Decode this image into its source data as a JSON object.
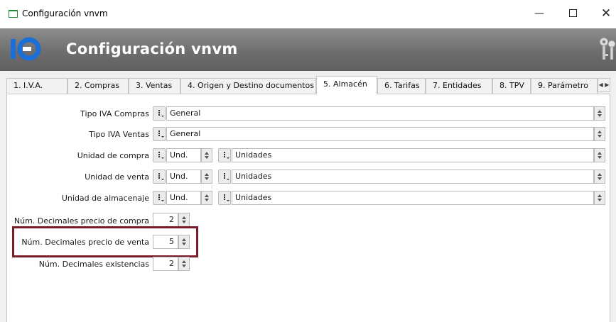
{
  "window": {
    "title": "Configuración vnvm",
    "minimize_icon": "minimize-icon",
    "maximize_icon": "maximize-icon",
    "close_icon": "close-icon",
    "minimize_glyph": "—",
    "close_glyph": "✕"
  },
  "header": {
    "title": "Configuración vnvm",
    "logo_icon": "app-logo",
    "keys_icon": "keys-icon",
    "brand_color": "#1c6fd6"
  },
  "tabs": [
    {
      "label": "1. I.V.A.",
      "active": false
    },
    {
      "label": "2. Compras",
      "active": false
    },
    {
      "label": "3. Ventas",
      "active": false
    },
    {
      "label": "4. Origen y Destino documentos",
      "active": false
    },
    {
      "label": "5. Almacén",
      "active": true
    },
    {
      "label": "6. Tarifas",
      "active": false
    },
    {
      "label": "7. Entidades",
      "active": false
    },
    {
      "label": "8. TPV",
      "active": false
    },
    {
      "label": "9. Parámetro",
      "active": false
    }
  ],
  "tab_scroll": {
    "left": "◀",
    "right": "▶"
  },
  "form": {
    "tipo_iva_compras": {
      "label": "Tipo IVA Compras",
      "value": "General"
    },
    "tipo_iva_ventas": {
      "label": "Tipo IVA Ventas",
      "value": "General"
    },
    "unidad_compra": {
      "label": "Unidad de compra",
      "code": "Und.",
      "name": "Unidades"
    },
    "unidad_venta": {
      "label": "Unidad de venta",
      "code": "Und.",
      "name": "Unidades"
    },
    "unidad_almacenaje": {
      "label": "Unidad de almacenaje",
      "code": "Und.",
      "name": "Unidades"
    },
    "decimales_compra": {
      "label": "Núm. Decimales precio de compra",
      "value": "2"
    },
    "decimales_venta": {
      "label": "Núm. Decimales precio de venta",
      "value": "5"
    },
    "decimales_existencias": {
      "label": "Núm. Decimales existencias",
      "value": "2"
    }
  },
  "highlight_color": "#7b1c2a"
}
